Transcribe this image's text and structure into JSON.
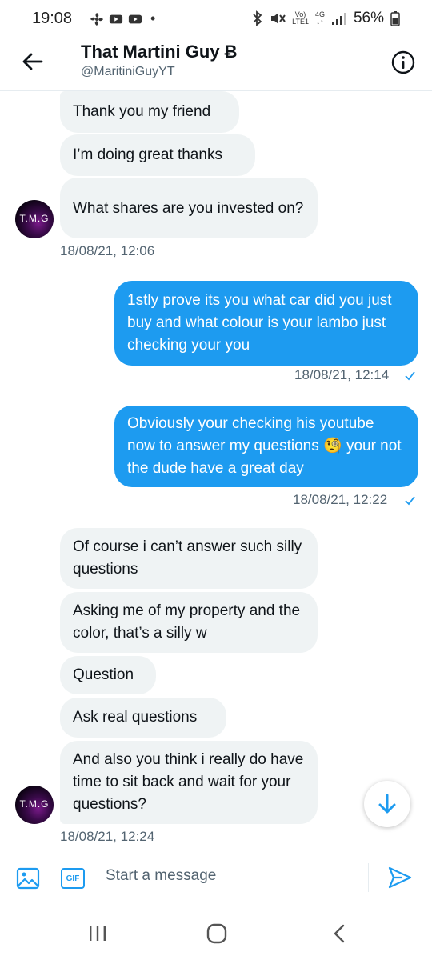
{
  "status_bar": {
    "time": "19:08",
    "dot": "•",
    "network_top": "Vo)",
    "network_bottom": "LTE1",
    "gen": "4G",
    "battery": "56%"
  },
  "header": {
    "title": "That Martini Guy Ƀ",
    "handle": "@MaritiniGuyYT"
  },
  "avatar": {
    "initials": "T.M.G"
  },
  "messages": [
    {
      "dir": "in",
      "text": "Thank you my friend"
    },
    {
      "dir": "in",
      "text": "I’m doing great thanks"
    },
    {
      "dir": "in",
      "text": "What shares are you invested on?"
    },
    {
      "dir": "ts",
      "text": "18/08/21, 12:06"
    },
    {
      "dir": "out",
      "text": "1stly prove its you what car did you just buy and what colour is your lambo  just checking your you"
    },
    {
      "dir": "ts",
      "text": "18/08/21, 12:14"
    },
    {
      "dir": "out",
      "text": "Obviously your checking his youtube now to answer my questions 🧐 your not the dude have a great day"
    },
    {
      "dir": "ts",
      "text": "18/08/21, 12:22"
    },
    {
      "dir": "in",
      "text": "Of course i can’t answer such silly questions"
    },
    {
      "dir": "in",
      "text": "Asking me of my property and the color, that’s a silly w"
    },
    {
      "dir": "in",
      "text": "Question"
    },
    {
      "dir": "in",
      "text": "Ask real questions"
    },
    {
      "dir": "in",
      "text": "And also you think i really do have time to sit back and wait for your questions?"
    },
    {
      "dir": "ts",
      "text": "18/08/21, 12:24"
    }
  ],
  "composer": {
    "placeholder": "Start a message",
    "gif_label": "GIF"
  },
  "colors": {
    "accent": "#1d9bf0",
    "incoming_bubble": "#eff3f4",
    "muted_text": "#536471"
  },
  "icons": [
    "back-arrow-icon",
    "info-icon",
    "image-icon",
    "gif-icon",
    "send-icon",
    "scroll-down-arrow-icon",
    "read-check-icon"
  ]
}
